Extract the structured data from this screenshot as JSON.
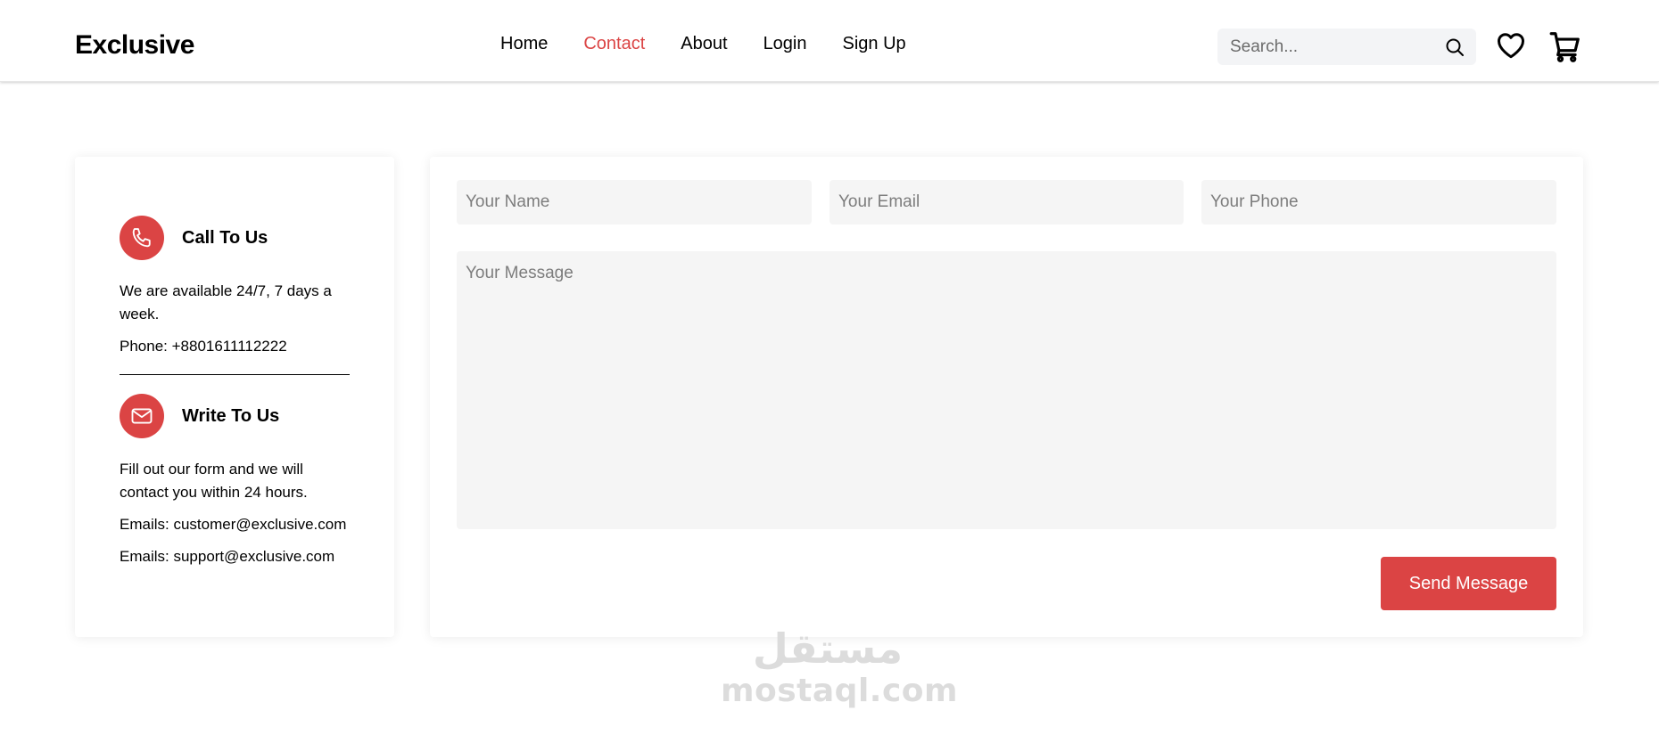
{
  "header": {
    "logo": "Exclusive",
    "nav": [
      {
        "label": "Home",
        "active": false
      },
      {
        "label": "Contact",
        "active": true
      },
      {
        "label": "About",
        "active": false
      },
      {
        "label": "Login",
        "active": false
      },
      {
        "label": "Sign Up",
        "active": false
      }
    ],
    "search_placeholder": "Search...",
    "icons": [
      "search-icon",
      "heart-icon",
      "cart-icon"
    ]
  },
  "contact_info": {
    "call": {
      "icon": "phone-icon",
      "title": "Call To Us",
      "description": "We are available 24/7, 7 days a week.",
      "phone": "Phone: +8801611112222"
    },
    "write": {
      "icon": "mail-icon",
      "title": "Write To Us",
      "description": "Fill out our form and we will contact you within 24 hours.",
      "email1": "Emails: customer@exclusive.com",
      "email2": "Emails: support@exclusive.com"
    }
  },
  "form": {
    "name_placeholder": "Your Name",
    "email_placeholder": "Your Email",
    "phone_placeholder": "Your Phone",
    "message_placeholder": "Your Message",
    "submit_label": "Send Message"
  },
  "watermark": {
    "arabic": "مستقل",
    "latin": "mostaql.com"
  },
  "colors": {
    "accent": "#db4444",
    "field_bg": "#f5f5f5",
    "search_bg": "#f3f4f6"
  }
}
